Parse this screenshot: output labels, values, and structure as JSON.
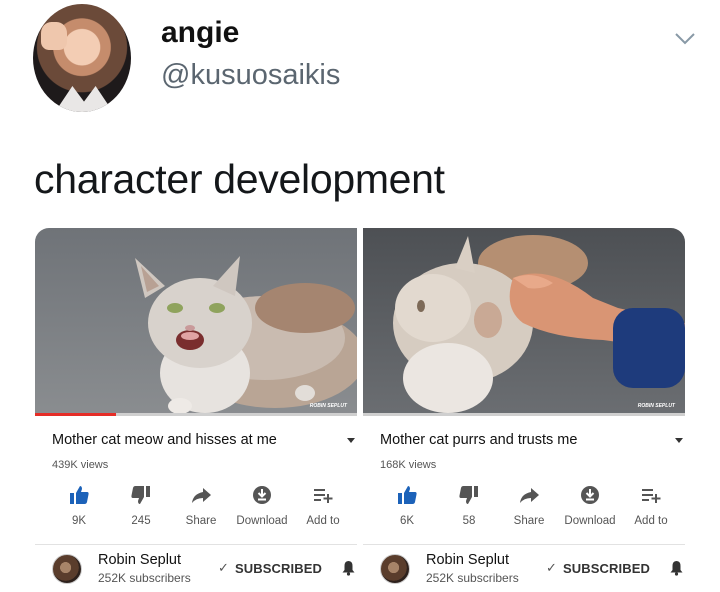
{
  "tweet": {
    "display_name": "angie",
    "handle": "@kusuosaikis",
    "text": "character development",
    "menu_icon": "chevron-down-icon"
  },
  "videos": [
    {
      "title": "Mother cat meow and hisses at me",
      "views": "439K views",
      "progress": 0.25,
      "actions": {
        "like": "9K",
        "dislike": "245",
        "share": "Share",
        "download": "Download",
        "add_to": "Add to"
      },
      "channel": {
        "name": "Robin Seplut",
        "subscribers": "252K subscribers",
        "subscribed_label": "SUBSCRIBED"
      }
    },
    {
      "title": "Mother cat purrs and trusts me",
      "views": "168K views",
      "progress": 0.0,
      "actions": {
        "like": "6K",
        "dislike": "58",
        "share": "Share",
        "download": "Download",
        "add_to": "Add to"
      },
      "channel": {
        "name": "Robin Seplut",
        "subscribers": "252K subscribers",
        "subscribed_label": "SUBSCRIBED"
      }
    }
  ],
  "colors": {
    "like_active": "#1c62b9",
    "progress": "#e52d27",
    "text_secondary": "#555555"
  }
}
